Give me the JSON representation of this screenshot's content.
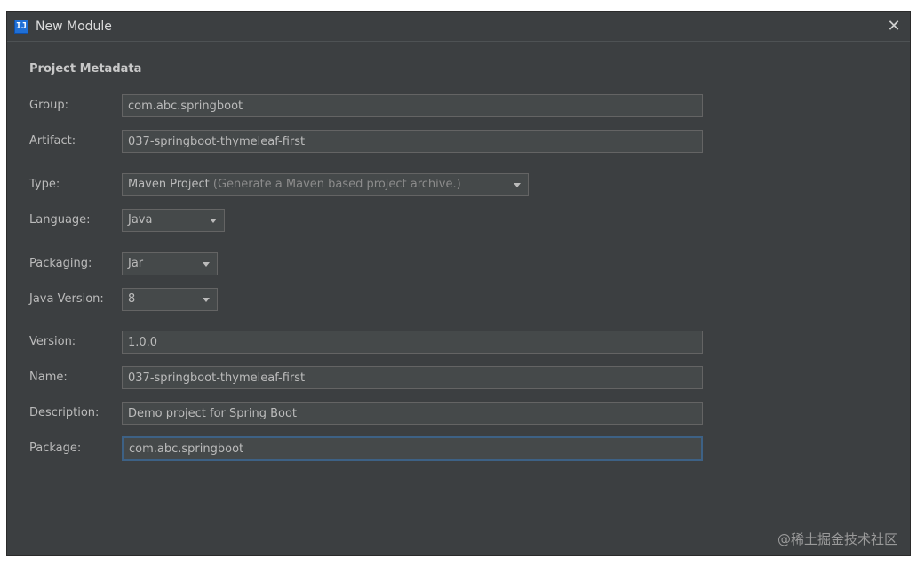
{
  "window": {
    "title": "New Module",
    "close_symbol": "✕",
    "app_icon_glyph": "IJ"
  },
  "section": {
    "title": "Project Metadata"
  },
  "fields": {
    "group": {
      "label": "Group:",
      "value": "com.abc.springboot"
    },
    "artifact": {
      "label": "Artifact:",
      "value": "037-springboot-thymeleaf-first"
    },
    "type": {
      "label": "Type:",
      "value": "Maven Project",
      "hint": "(Generate a Maven based project archive.)"
    },
    "language": {
      "label": "Language:",
      "value": "Java"
    },
    "packaging": {
      "label": "Packaging:",
      "value": "Jar"
    },
    "java_version": {
      "label": "Java Version:",
      "value": "8"
    },
    "version": {
      "label": "Version:",
      "value": "1.0.0"
    },
    "name": {
      "label": "Name:",
      "value": "037-springboot-thymeleaf-first"
    },
    "description": {
      "label": "Description:",
      "value": "Demo project for Spring Boot"
    },
    "package": {
      "label": "Package:",
      "value": "com.abc.springboot"
    }
  },
  "watermark": "@稀土掘金技术社区",
  "colors": {
    "background": "#3c3f41",
    "field_background": "#45494a",
    "field_border": "#646464",
    "focus_border": "#3d6185",
    "text": "#bbbbbb"
  },
  "icons": {
    "app": "intellij-icon",
    "close": "close-icon",
    "dropdown": "chevron-down-icon"
  }
}
